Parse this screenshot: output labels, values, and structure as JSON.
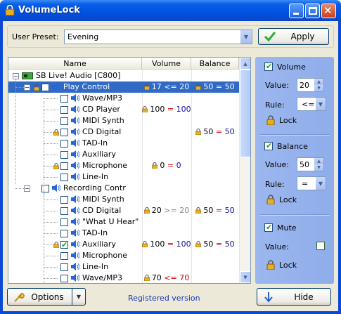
{
  "app": {
    "title": "VolumeLock"
  },
  "preset": {
    "label": "User Preset:",
    "value": "Evening",
    "apply_label": "Apply"
  },
  "columns": [
    "Name",
    "Volume",
    "Balance"
  ],
  "rows": [
    {
      "name": "SB Live! Audio [C800]",
      "vol": "",
      "bal": ""
    },
    {
      "name": "Play Control",
      "vol_a": "17",
      "vol_op": "<=",
      "vol_b": "20",
      "bal_a": "50",
      "bal_op": "=",
      "bal_b": "50"
    },
    {
      "name": "Wave/MP3"
    },
    {
      "name": "CD Player",
      "vol_a": "100",
      "vol_op": "=",
      "vol_b": "100"
    },
    {
      "name": "MIDI Synth"
    },
    {
      "name": "CD Digital",
      "bal_a": "50",
      "bal_op": "=",
      "bal_b": "50"
    },
    {
      "name": "TAD-In"
    },
    {
      "name": "Auxiliary"
    },
    {
      "name": "Microphone",
      "vol_a": "0",
      "vol_op": "=",
      "vol_b": "0"
    },
    {
      "name": "Line-In"
    },
    {
      "name": "Recording Contr"
    },
    {
      "name": "MIDI Synth"
    },
    {
      "name": "CD Digital",
      "vol_a": "20",
      "vol_op": ">=",
      "vol_b": "20",
      "bal_a": "50",
      "bal_op": "=",
      "bal_b": "50"
    },
    {
      "name": "\"What U Hear\""
    },
    {
      "name": "TAD-In"
    },
    {
      "name": "Auxiliary",
      "vol_a": "100",
      "vol_op": "=",
      "vol_b": "100",
      "bal_a": "50",
      "bal_op": "=",
      "bal_b": "50"
    },
    {
      "name": "Microphone"
    },
    {
      "name": "Line-In"
    },
    {
      "name": "Wave/MP3",
      "vol_a": "70",
      "vol_op": "<=",
      "vol_b": "70"
    }
  ],
  "side": {
    "volume": {
      "label": "Volume",
      "value_label": "Value:",
      "value": "20",
      "rule_label": "Rule:",
      "rule": "<=",
      "lock_label": "Lock"
    },
    "balance": {
      "label": "Balance",
      "value_label": "Value:",
      "value": "50",
      "rule_label": "Rule:",
      "rule": "=",
      "lock_label": "Lock"
    },
    "mute": {
      "label": "Mute",
      "value_label": "Value:",
      "lock_label": "Lock"
    }
  },
  "footer": {
    "options_label": "Options",
    "registered": "Registered version",
    "hide_label": "Hide"
  }
}
